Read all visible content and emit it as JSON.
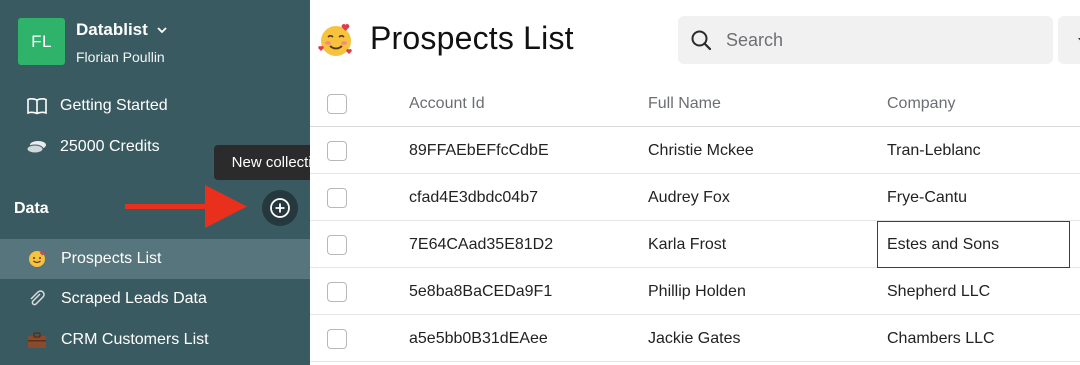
{
  "workspace": {
    "initials": "FL",
    "name": "Datablist",
    "user": "Florian Poullin",
    "avatar_color": "#2fb36a"
  },
  "sidebar": {
    "nav": [
      {
        "label": "Getting Started",
        "icon": "book-icon"
      },
      {
        "label": "25000 Credits",
        "icon": "coins-icon"
      }
    ],
    "section_label": "Data",
    "tooltip": "New collection",
    "collections": [
      {
        "label": "Prospects List",
        "icon": "smiling-face-hearts-icon",
        "active": true
      },
      {
        "label": "Scraped Leads Data",
        "icon": "paperclip-icon",
        "active": false
      },
      {
        "label": "CRM Customers List",
        "icon": "briefcase-icon",
        "active": false
      }
    ],
    "bg_color": "#3a5a61",
    "active_color": "#56757c"
  },
  "main": {
    "title": "Prospects List",
    "search": {
      "placeholder": "Search",
      "value": ""
    },
    "table": {
      "columns": [
        "Account Id",
        "Full Name",
        "Company"
      ],
      "rows": [
        [
          "89FFAEbEFfcCdbE",
          "Christie Mckee",
          "Tran-Leblanc"
        ],
        [
          "cfad4E3dbdc04b7",
          "Audrey Fox",
          "Frye-Cantu"
        ],
        [
          "7E64CAad35E81D2",
          "Karla Frost",
          "Estes and Sons"
        ],
        [
          "5e8ba8BaCEDa9F1",
          "Phillip Holden",
          "Shepherd LLC"
        ],
        [
          "a5e5bb0B31dEAee",
          "Jackie Gates",
          "Chambers LLC"
        ]
      ],
      "selected_cell_color": "#6b2a2a"
    }
  },
  "annotation": {
    "arrow_color": "#e8301c"
  }
}
